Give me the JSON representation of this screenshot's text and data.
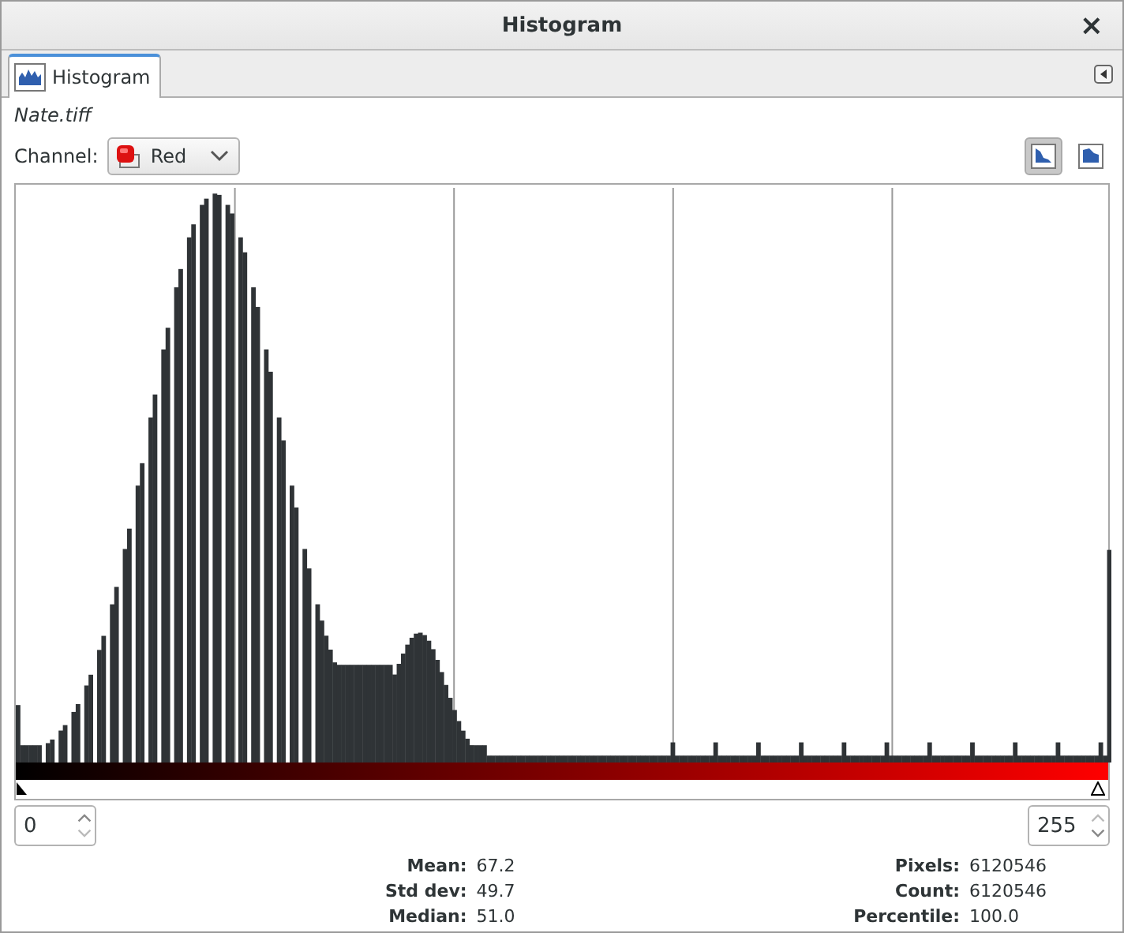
{
  "window": {
    "title": "Histogram",
    "close": "×"
  },
  "tabs": [
    {
      "label": "Histogram",
      "selected": true
    }
  ],
  "image_name": "Nate.tiff",
  "channel": {
    "label": "Channel:",
    "value": "Red"
  },
  "view_modes": [
    {
      "kind": "linear",
      "selected": true
    },
    {
      "kind": "log",
      "selected": false
    }
  ],
  "range": {
    "low": "0",
    "high": "255"
  },
  "stats_left": [
    {
      "label": "Mean:",
      "value": "67.2"
    },
    {
      "label": "Std dev:",
      "value": "49.7"
    },
    {
      "label": "Median:",
      "value": "51.0"
    }
  ],
  "stats_right": [
    {
      "label": "Pixels:",
      "value": "6120546"
    },
    {
      "label": "Count:",
      "value": "6120546"
    },
    {
      "label": "Percentile:",
      "value": "100.0"
    }
  ]
}
